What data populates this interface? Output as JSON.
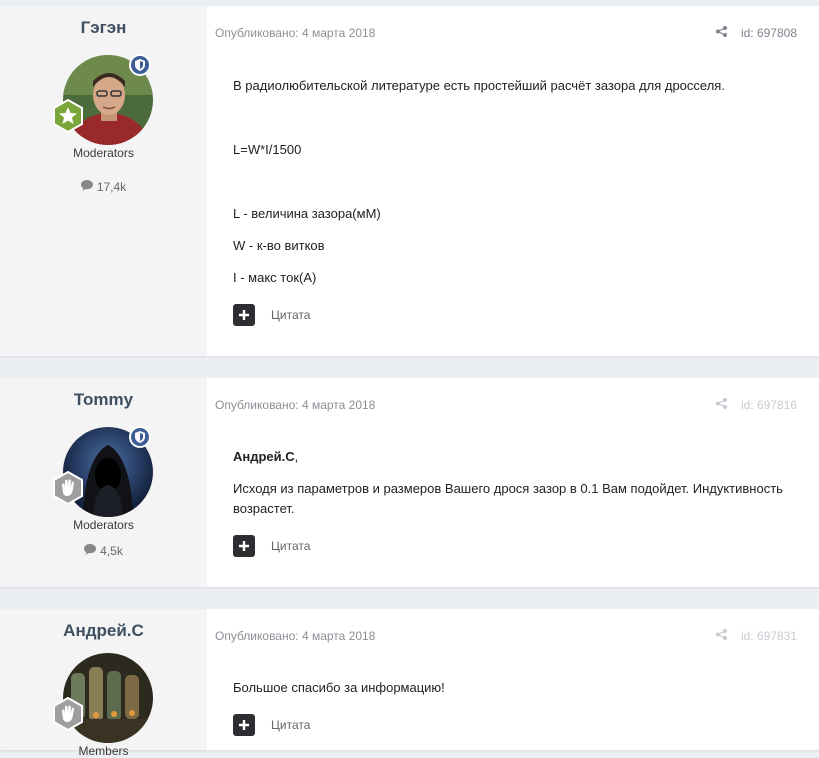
{
  "posts": [
    {
      "author": "Гэгэн",
      "group": "Moderators",
      "post_count": "17,4k",
      "date": "Опубликовано: 4 марта 2018",
      "post_id": "id: 697808",
      "lines": [
        "В радиолюбительской литературе есть простейший расчёт зазора для дросселя.",
        "L=W*I/1500",
        "L - величина зазора(мМ)",
        "W - к-во витков",
        "I - макс ток(А)"
      ],
      "quote_label": "Цитата"
    },
    {
      "author": "Tommy",
      "group": "Moderators",
      "post_count": "4,5k",
      "date": "Опубликовано: 4 марта 2018",
      "post_id": "id: 697816",
      "mention": "Андрей.С",
      "mention_suffix": ",",
      "lines": [
        "Исходя из параметров и размеров Вашего дрося зазор в 0.1 Вам подойдет. Индуктивность возрастет."
      ],
      "quote_label": "Цитата"
    },
    {
      "author": "Андрей.С",
      "group": "Members",
      "date": "Опубликовано: 4 марта 2018",
      "post_id": "id: 697831",
      "lines": [
        "Большое спасибо за информацию!"
      ],
      "quote_label": "Цитата"
    }
  ],
  "icons": {
    "share": "share-icon",
    "plus": "plus-icon",
    "comment": "comment-icon",
    "shield": "shield-icon",
    "star": "star-icon",
    "hand": "hand-icon"
  },
  "colors": {
    "author_name": "#3d4f60",
    "shield_badge": "#3e5f96",
    "rank_green": "#7aa63a",
    "rank_gray": "#9e9e9e",
    "action_button": "#2c2e31"
  }
}
